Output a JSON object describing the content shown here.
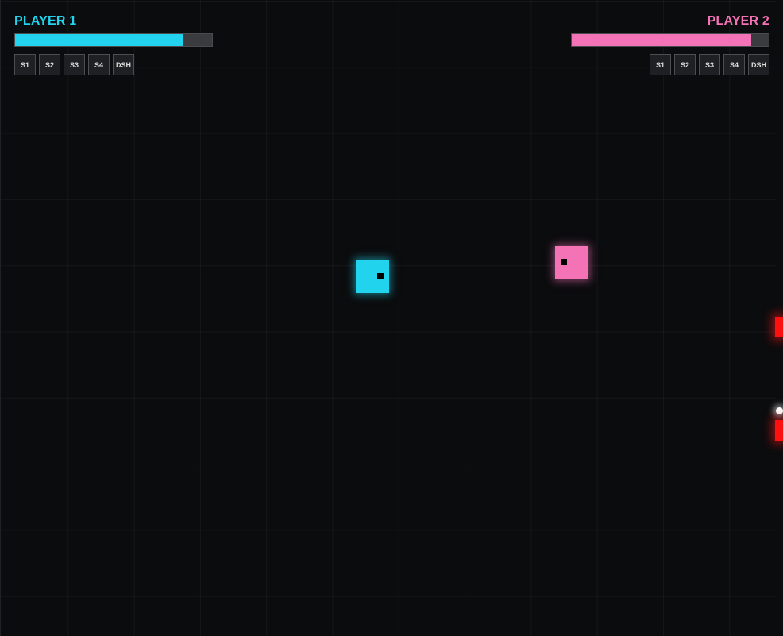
{
  "players": [
    {
      "label": "PLAYER 1",
      "color": "#22d3ee",
      "health_fraction": 0.85,
      "slots": [
        "S1",
        "S2",
        "S3",
        "S4",
        "DSH"
      ]
    },
    {
      "label": "PLAYER 2",
      "color": "#f472b6",
      "health_fraction": 0.91,
      "slots": [
        "S1",
        "S2",
        "S3",
        "S4",
        "DSH"
      ]
    }
  ],
  "colors": {
    "background": "#0b0c0e",
    "hazard": "#ff1010",
    "orb": "#ffffff"
  }
}
